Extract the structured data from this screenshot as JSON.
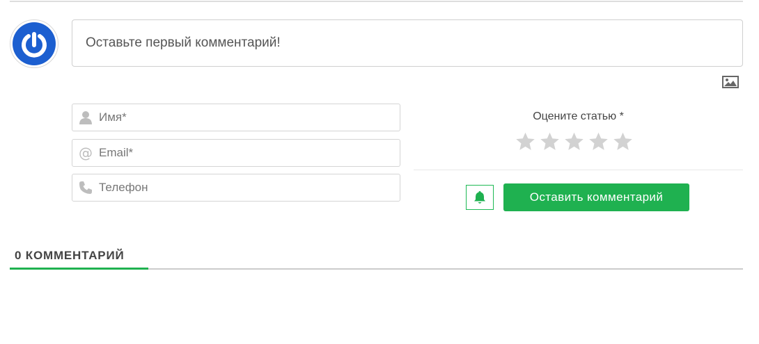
{
  "colors": {
    "accent": "#1fb150",
    "avatar_blue": "#1c5fd0",
    "star": "#d2d2d2"
  },
  "avatar": {
    "icon": "power-icon"
  },
  "comment": {
    "placeholder": "Оставьте первый комментарий!"
  },
  "attach": {
    "icon": "image-icon"
  },
  "form": {
    "name": {
      "placeholder": "Имя*",
      "icon": "user-icon"
    },
    "email": {
      "placeholder": "Email*",
      "icon": "at-icon"
    },
    "phone": {
      "placeholder": "Телефон",
      "icon": "phone-icon"
    }
  },
  "rating": {
    "label": "Оцените статью *",
    "max": 5,
    "value": 0
  },
  "subscribe": {
    "icon": "bell-icon"
  },
  "submit": {
    "label": "Оставить комментарий"
  },
  "comments_tab": {
    "title": "0 КОММЕНТАРИЙ"
  }
}
